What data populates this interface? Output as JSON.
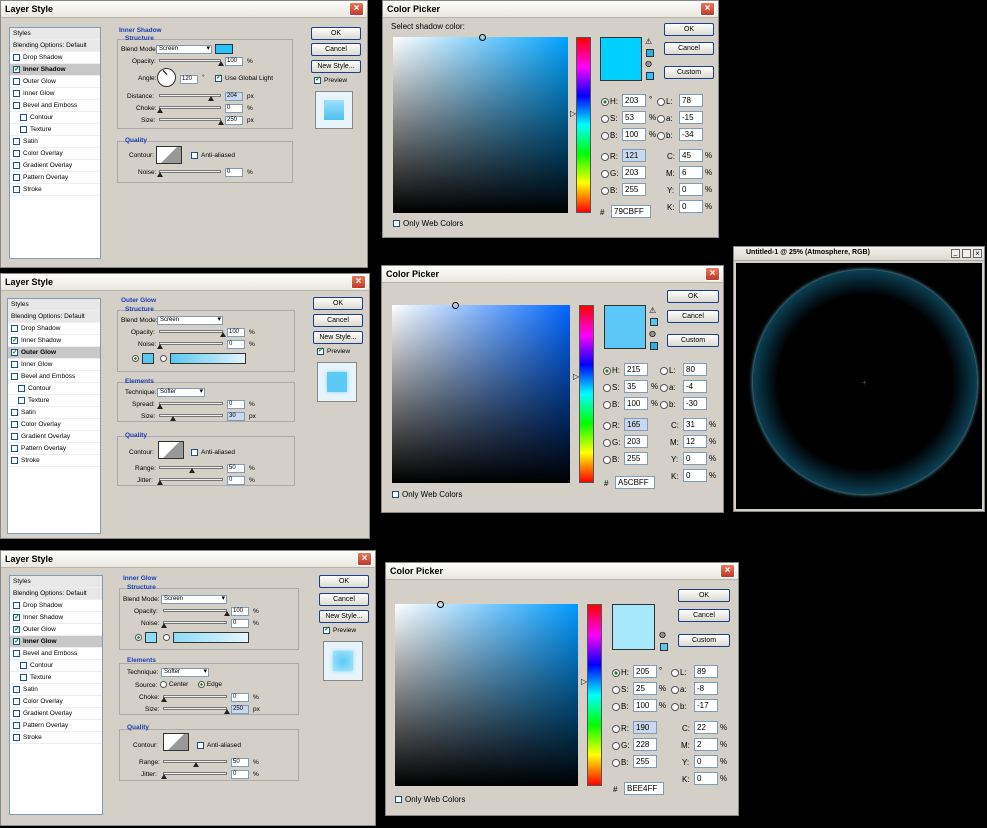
{
  "layer_style": {
    "title": "Layer Style",
    "ok": "OK",
    "cancel": "Cancel",
    "new_style": "New Style...",
    "preview": "Preview",
    "styles_header": "Styles",
    "blending_options": "Blending Options: Default",
    "style_items": [
      "Drop Shadow",
      "Inner Shadow",
      "Outer Glow",
      "Inner Glow",
      "Bevel and Emboss",
      "Contour",
      "Texture",
      "Satin",
      "Color Overlay",
      "Gradient Overlay",
      "Pattern Overlay",
      "Stroke"
    ],
    "structure": "Structure",
    "quality": "Quality",
    "elements": "Elements",
    "blend_mode_label": "Blend Mode:",
    "opacity_label": "Opacity:",
    "noise_label": "Noise:",
    "contour_label": "Contour:",
    "anti_aliased": "Anti-aliased",
    "technique_label": "Technique:",
    "spread_label": "Spread:",
    "size_label": "Size:",
    "range_label": "Range:",
    "jitter_label": "Jitter:",
    "choke_label": "Choke:",
    "source_label": "Source:",
    "center": "Center",
    "edge": "Edge",
    "pct": "%",
    "px": "px",
    "screen": "Screen",
    "softer": "Softer"
  },
  "d1": {
    "section": "Inner Shadow",
    "opacity": "100",
    "angle_label": "Angle:",
    "angle": "120",
    "deg": "°",
    "use_global_light": "Use Global Light",
    "distance_label": "Distance:",
    "distance": "204",
    "choke": "0",
    "size": "250",
    "noise": "0"
  },
  "d2": {
    "section": "Outer Glow",
    "opacity": "100",
    "noise": "0",
    "spread": "0",
    "size": "30",
    "range": "50",
    "jitter": "0"
  },
  "d3": {
    "section": "Inner Glow",
    "opacity": "100",
    "noise": "0",
    "choke": "0",
    "size": "250",
    "range": "50",
    "jitter": "0"
  },
  "cp_common": {
    "title": "Color Picker",
    "ok": "OK",
    "cancel": "Cancel",
    "custom": "Custom",
    "only_web": "Only Web Colors",
    "hash": "#",
    "deg": "°",
    "pct": "%",
    "h": "H:",
    "s": "S:",
    "b": "B:",
    "r": "R:",
    "g": "G:",
    "bl": "B:",
    "l": "L:",
    "a": "a:",
    "b2": "b:",
    "c": "C:",
    "m": "M:",
    "y": "Y:",
    "k": "K:"
  },
  "cp1": {
    "prompt": "Select shadow color:",
    "swatch": "#79cbff",
    "H": "203",
    "S": "53",
    "B": "100",
    "R": "121",
    "G": "203",
    "Bv": "255",
    "L": "78",
    "a": "-15",
    "b": "-34",
    "C": "45",
    "M": "6",
    "Y": "0",
    "K": "0",
    "hex": "79CBFF"
  },
  "cp2": {
    "swatch": "#a5cbff",
    "H": "215",
    "S": "35",
    "B": "100",
    "R": "165",
    "G": "203",
    "Bv": "255",
    "L": "80",
    "a": "-4",
    "b": "-30",
    "C": "31",
    "M": "12",
    "Y": "0",
    "K": "0",
    "hex": "A5CBFF"
  },
  "cp3": {
    "swatch": "#bee4ff",
    "H": "205",
    "S": "25",
    "B": "100",
    "R": "190",
    "G": "228",
    "Bv": "255",
    "L": "89",
    "a": "-8",
    "b": "-17",
    "C": "22",
    "M": "2",
    "Y": "0",
    "K": "0",
    "hex": "BEE4FF"
  },
  "doc": {
    "title": "Untitled-1 @ 25% (Atmosphere, RGB)"
  },
  "colors": {
    "accent": "#29c4ff",
    "glow": "#5bc8f0"
  }
}
